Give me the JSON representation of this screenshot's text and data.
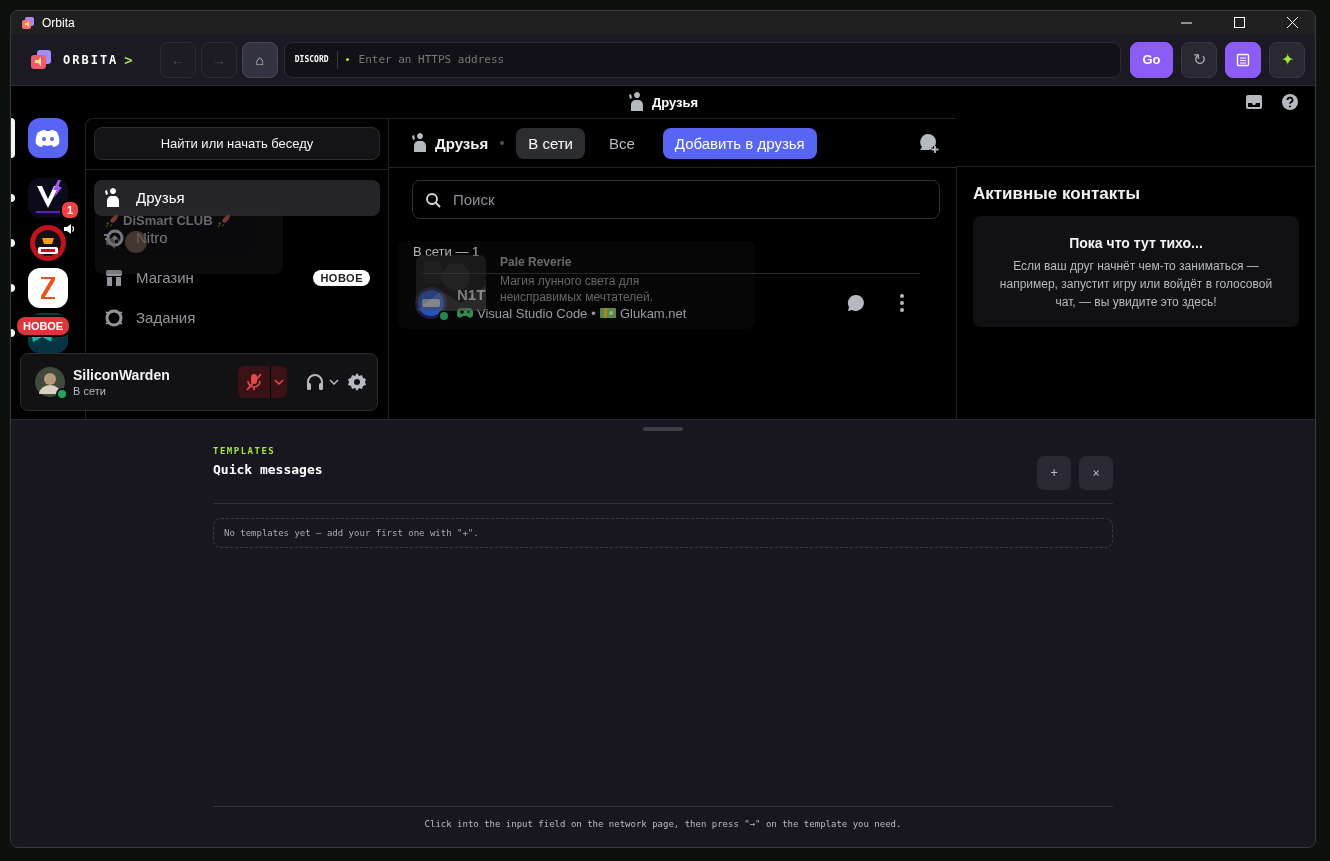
{
  "window": {
    "title": "Orbita"
  },
  "toolbar": {
    "brand": "ORBITA",
    "brand_arrow": ">",
    "nav_buttons": [
      {
        "glyph": "←",
        "disabled": true
      },
      {
        "glyph": "→",
        "disabled": true
      },
      {
        "glyph": "⌂",
        "disabled": false
      }
    ],
    "address": {
      "service": "DISCORD",
      "placeholder": "Enter an HTTPS address"
    },
    "right_buttons": [
      {
        "kind": "text",
        "label": "Go",
        "highlighted": true
      },
      {
        "kind": "text",
        "label": "↻",
        "highlighted": false
      },
      {
        "kind": "list",
        "highlighted": true
      },
      {
        "kind": "sparkle",
        "label": "✦",
        "highlighted": false
      }
    ]
  },
  "discord": {
    "title": "Друзья",
    "servers": [
      {
        "kind": "discord",
        "selected": true,
        "unread": false
      },
      {
        "kind": "vibe",
        "selected": false,
        "unread": true,
        "badge": "1"
      },
      {
        "kind": "club",
        "selected": false,
        "unread": true,
        "speaking": true
      },
      {
        "kind": "z",
        "selected": false,
        "unread": true
      },
      {
        "kind": "teal",
        "selected": false,
        "unread": true,
        "new_label": "НОВОЕ"
      }
    ],
    "tooltip": {
      "text": "DiSmart CLUB"
    },
    "search_button": "Найти или начать беседу",
    "nav": [
      {
        "kind": "friends",
        "label": "Друзья",
        "selected": true
      },
      {
        "kind": "nitro",
        "label": "Nitro",
        "selected": false
      },
      {
        "kind": "shop",
        "label": "Магазин",
        "selected": false,
        "badge": "НОВОЕ"
      },
      {
        "kind": "quests",
        "label": "Задания",
        "selected": false
      }
    ],
    "user": {
      "name": "SiliconWarden",
      "status": "В сети",
      "online": true,
      "mic_muted": true
    },
    "friends_header": {
      "title": "Друзья",
      "tabs": [
        {
          "label": "В сети",
          "selected": true
        },
        {
          "label": "Все",
          "selected": false
        }
      ],
      "add_button": "Добавить в друзья"
    },
    "search": {
      "placeholder": "Поиск"
    },
    "section_label": "В сети — 1",
    "friends": [
      {
        "name": "N1T",
        "online": true,
        "activity": "Visual Studio Code",
        "separator": "•",
        "app": "Glukam.net"
      }
    ],
    "hover_card": {
      "title": "Pale Reverie",
      "description": "Магия лунного света для неисправимых мечтателей."
    },
    "active_now": {
      "title": "Активные контакты",
      "empty_title": "Пока что тут тихо...",
      "empty_text": "Если ваш друг начнёт чем-то заниматься — например, запустит игру или войдёт в голосовой чат, — вы увидите это здесь!"
    }
  },
  "templates": {
    "eyebrow": "TEMPLATES",
    "title": "Quick messages",
    "add_button": "+",
    "close_button": "×",
    "empty": "No templates yet — add your first one with \"+\".",
    "hint": "Click into the input field on the network page, then press \"→\" on the template you need."
  }
}
